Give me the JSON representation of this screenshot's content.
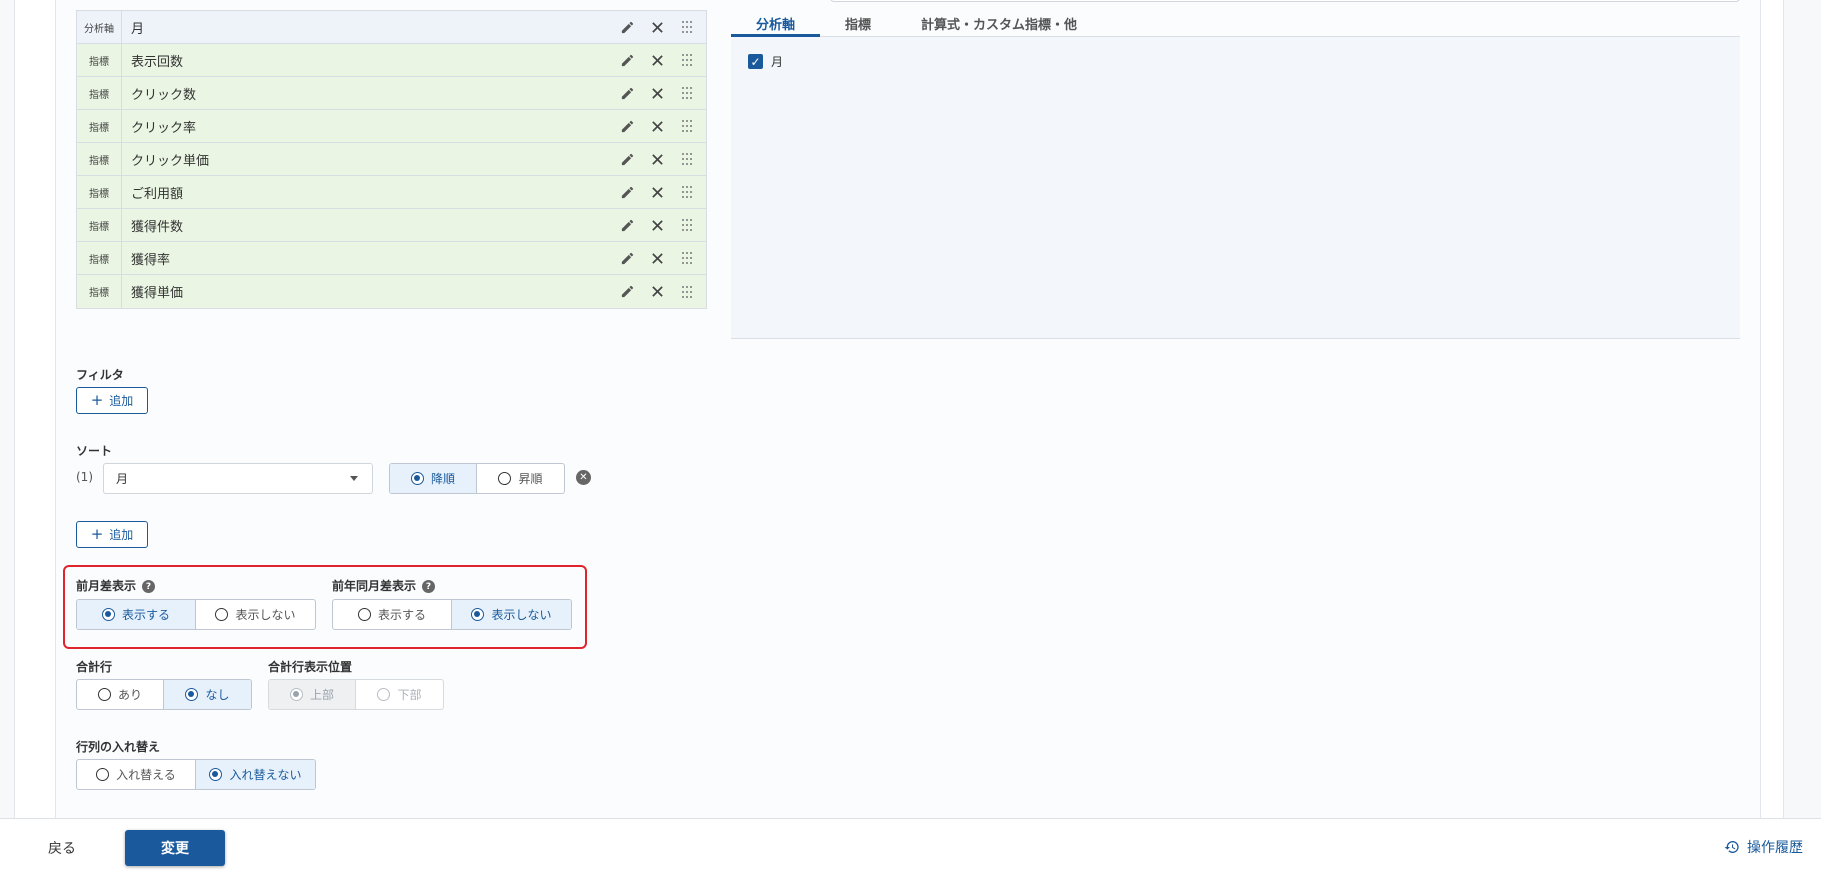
{
  "metrics_table": {
    "rows": [
      {
        "tag": "分析軸",
        "label": "月",
        "kind": "axis"
      },
      {
        "tag": "指標",
        "label": "表示回数",
        "kind": "metric"
      },
      {
        "tag": "指標",
        "label": "クリック数",
        "kind": "metric"
      },
      {
        "tag": "指標",
        "label": "クリック率",
        "kind": "metric"
      },
      {
        "tag": "指標",
        "label": "クリック単価",
        "kind": "metric"
      },
      {
        "tag": "指標",
        "label": "ご利用額",
        "kind": "metric"
      },
      {
        "tag": "指標",
        "label": "獲得件数",
        "kind": "metric"
      },
      {
        "tag": "指標",
        "label": "獲得率",
        "kind": "metric"
      },
      {
        "tag": "指標",
        "label": "獲得単価",
        "kind": "metric"
      }
    ],
    "icons": {
      "edit": "pencil-icon",
      "remove": "close-icon",
      "drag": "drag-handle-icon"
    }
  },
  "right_panel": {
    "tabs": [
      "分析軸",
      "指標",
      "計算式・カスタム指標・他"
    ],
    "active_tab": "分析軸",
    "checkbox_items": [
      {
        "label": "月",
        "checked": true
      }
    ]
  },
  "filter": {
    "title": "フィルタ",
    "add_label": "追加"
  },
  "sort": {
    "title": "ソート",
    "index": "(1)",
    "selected": "月",
    "order_options": [
      "降順",
      "昇順"
    ],
    "order_selected": "降順",
    "add_label": "追加"
  },
  "prev_month": {
    "title": "前月差表示",
    "options": [
      "表示する",
      "表示しない"
    ],
    "selected": "表示する"
  },
  "prev_year": {
    "title": "前年同月差表示",
    "options": [
      "表示する",
      "表示しない"
    ],
    "selected": "表示しない"
  },
  "total_row": {
    "title": "合計行",
    "options": [
      "あり",
      "なし"
    ],
    "selected": "なし"
  },
  "total_position": {
    "title": "合計行表示位置",
    "options": [
      "上部",
      "下部"
    ],
    "selected": "上部",
    "disabled": true
  },
  "transpose": {
    "title": "行列の入れ替え",
    "options": [
      "入れ替える",
      "入れ替えない"
    ],
    "selected": "入れ替えない"
  },
  "footer": {
    "back_label": "戻る",
    "change_label": "変更",
    "history_label": "操作履歴"
  },
  "colors": {
    "accent": "#1a5a9c",
    "highlight": "#e0242b",
    "metric_row_bg": "#eaf5e3",
    "axis_row_bg": "#eef3fa"
  }
}
